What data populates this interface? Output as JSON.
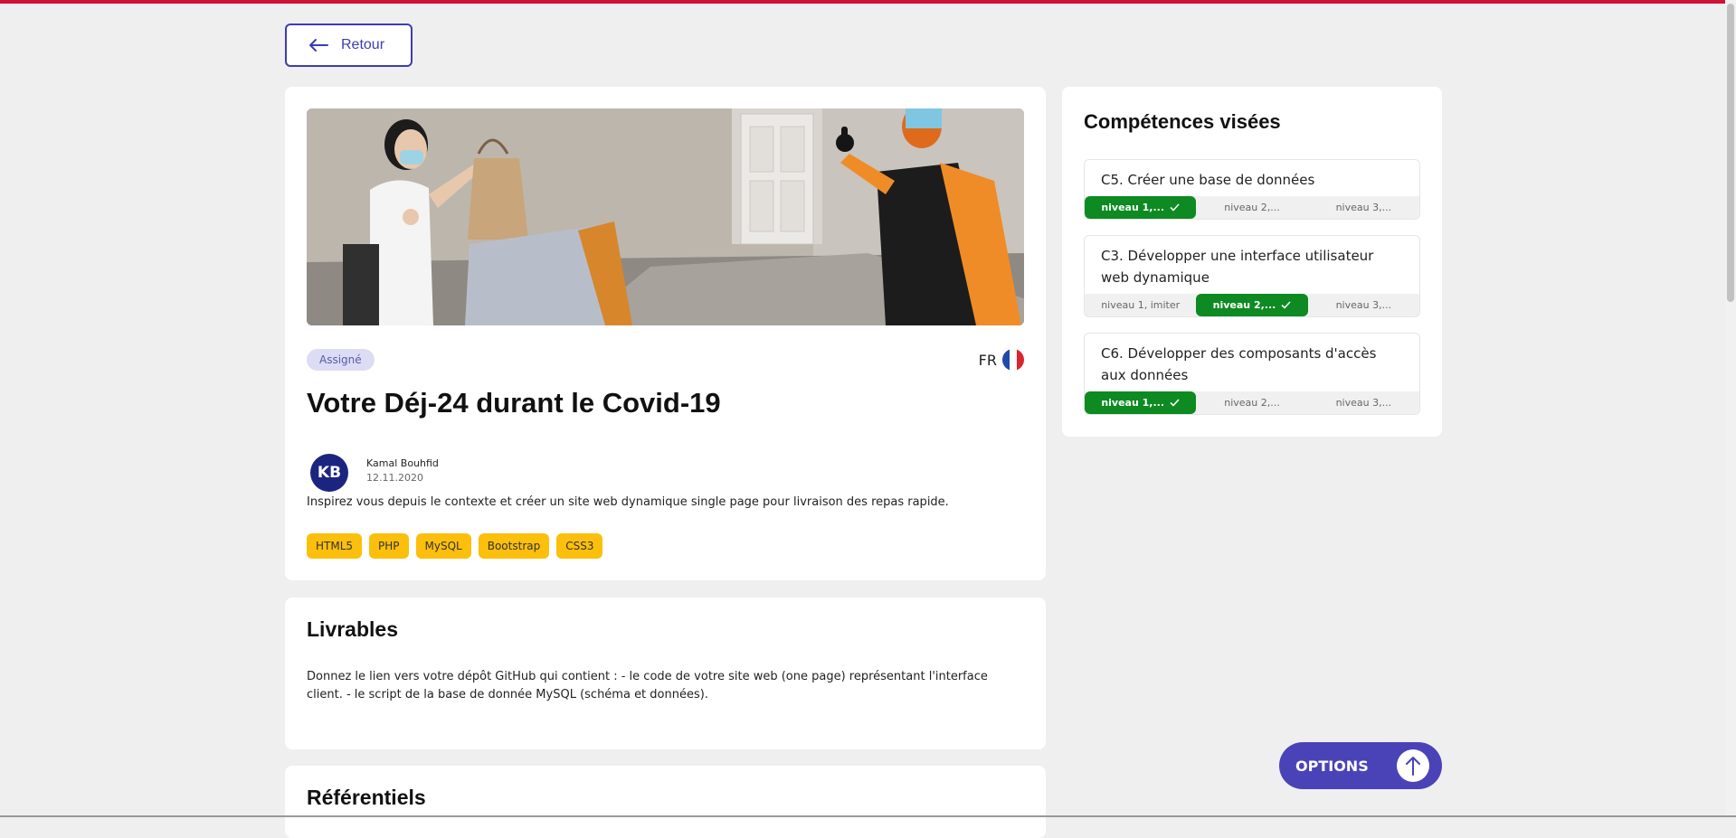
{
  "nav": {
    "back_label": "Retour"
  },
  "project": {
    "status": "Assigné",
    "language": "FR",
    "title": "Votre Déj-24 durant le Covid-19",
    "author_initials": "KB",
    "author": "Kamal Bouhfid",
    "date": "12.11.2020",
    "description": "Inspirez vous depuis le contexte et créer un site web dynamique single page pour livraison des repas rapide.",
    "tags": [
      "HTML5",
      "PHP",
      "MySQL",
      "Bootstrap",
      "CSS3"
    ]
  },
  "livrables": {
    "title": "Livrables",
    "text": "Donnez le lien vers votre dépôt GitHub qui contient : - le code de votre site web (one page) représentant l'interface client. - le script de la base de donnée MySQL (schéma et données)."
  },
  "referentiels": {
    "title": "Référentiels"
  },
  "competences": {
    "title": "Compétences visées",
    "items": [
      {
        "name": "C5. Créer une base de données",
        "levels": [
          "niveau 1,...",
          "niveau 2,...",
          "niveau 3,..."
        ],
        "active": 0
      },
      {
        "name": "C3. Développer une interface utilisateur web dynamique",
        "levels": [
          "niveau 1, imiter",
          "niveau 2,...",
          "niveau 3,..."
        ],
        "active": 1
      },
      {
        "name": "C6. Développer des composants d'accès aux données",
        "levels": [
          "niveau 1,...",
          "niveau 2,...",
          "niveau 3,..."
        ],
        "active": 0
      }
    ]
  },
  "options": {
    "label": "OPTIONS"
  },
  "colors": {
    "accent": "#3d3db0",
    "top_bar": "#cf1337",
    "tag": "#fbbf0c",
    "level_active": "#0d8a22",
    "options_button": "#4a43b8"
  },
  "icons": [
    "arrow-left-icon",
    "france-flag-icon",
    "check-icon",
    "arrow-up-icon"
  ]
}
